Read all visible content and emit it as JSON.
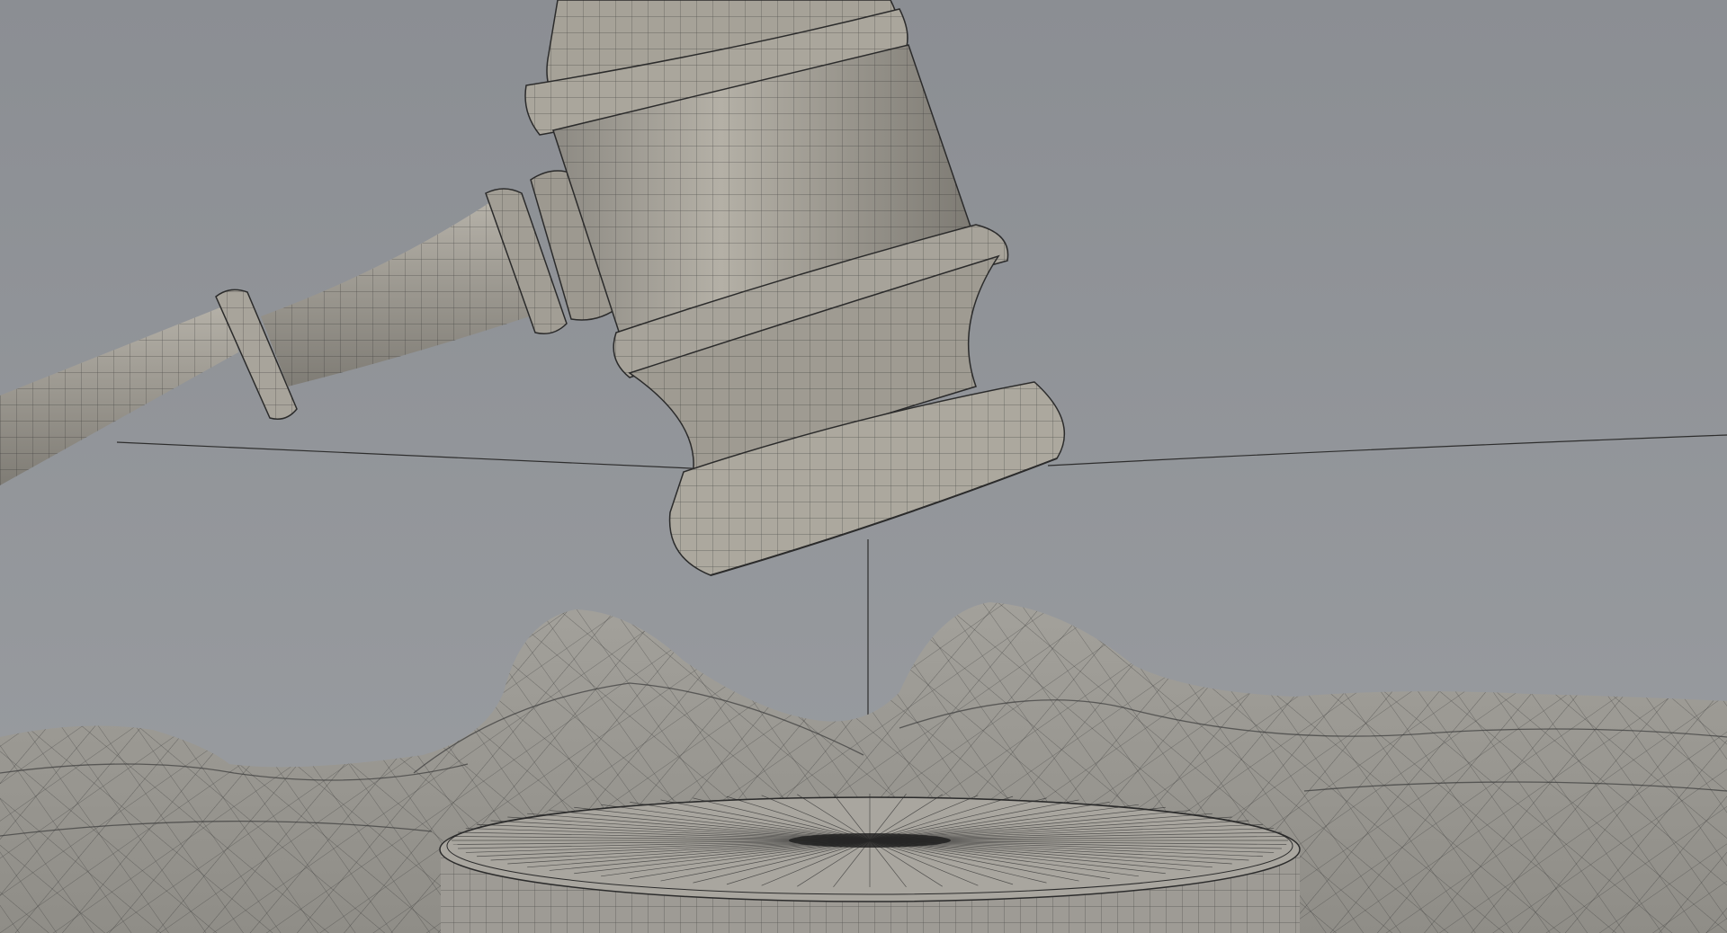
{
  "scene": {
    "subject": "3d-wireframe-gavel-render",
    "colors": {
      "background_top": "#8b8e93",
      "background_bottom": "#9a9da1",
      "surface": "#a7a39a",
      "surface_shadow": "#7e7b74",
      "wire": "#2b2b2b"
    }
  }
}
